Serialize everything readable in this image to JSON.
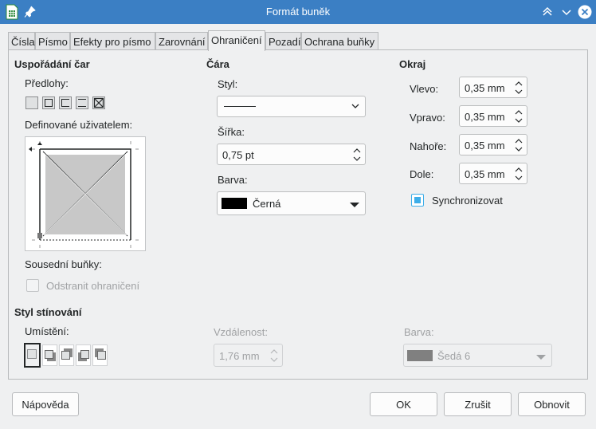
{
  "window": {
    "title": "Formát buněk",
    "app_icon": "spreadsheet-app-icon",
    "pin_icon": "pin-icon",
    "controls": [
      "keep-above-icon",
      "minimize-icon",
      "close-icon"
    ],
    "title_bar_color": "#3b7fc4"
  },
  "tabs": [
    {
      "label": "Čísla",
      "active": false
    },
    {
      "label": "Písmo",
      "active": false
    },
    {
      "label": "Efekty pro písmo",
      "active": false
    },
    {
      "label": "Zarovnání",
      "active": false
    },
    {
      "label": "Ohraničení",
      "active": true
    },
    {
      "label": "Pozadí",
      "active": false
    },
    {
      "label": "Ochrana buňky",
      "active": false
    }
  ],
  "line_arrangement": {
    "header": "Uspořádání čar",
    "presets_label": "Předlohy:",
    "user_defined_label": "Definované uživatelem:",
    "adjacent_label": "Sousední buňky:",
    "remove_border_label": "Odstranit ohraničení",
    "remove_border_checked": false
  },
  "line": {
    "header": "Čára",
    "style_label": "Styl:",
    "width_label": "Šířka:",
    "width_value": "0,75 pt",
    "color_label": "Barva:",
    "color_value": "Černá",
    "color_swatch": "#000000"
  },
  "padding": {
    "header": "Okraj",
    "left_label": "Vlevo:",
    "left_value": "0,35 mm",
    "right_label": "Vpravo:",
    "right_value": "0,35 mm",
    "top_label": "Nahoře:",
    "top_value": "0,35 mm",
    "bottom_label": "Dole:",
    "bottom_value": "0,35 mm",
    "sync_label": "Synchronizovat",
    "sync_checked": true,
    "accent": "#3daee9"
  },
  "shadow": {
    "header": "Styl stínování",
    "position_label": "Umístění:",
    "distance_label": "Vzdálenost:",
    "distance_value": "1,76 mm",
    "color_label": "Barva:",
    "color_value": "Šedá 6",
    "color_swatch": "#808080"
  },
  "buttons": {
    "help": "Nápověda",
    "ok": "OK",
    "cancel": "Zrušit",
    "reset": "Obnovit"
  }
}
